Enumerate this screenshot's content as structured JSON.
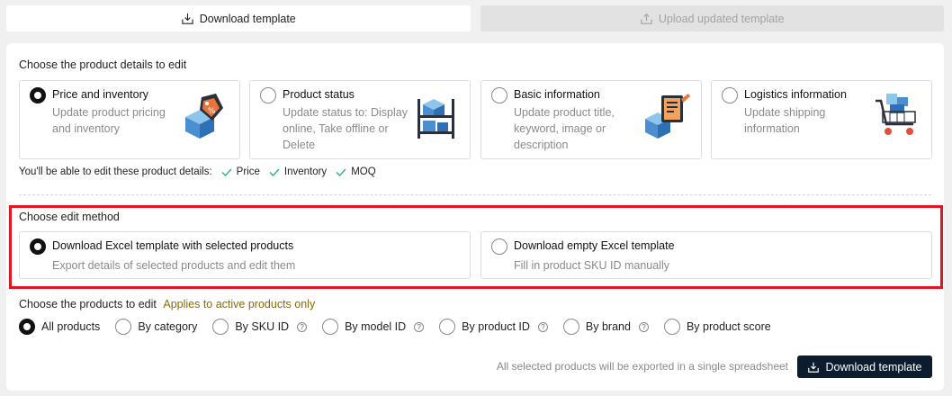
{
  "tabs": {
    "download": "Download template",
    "upload": "Upload updated template"
  },
  "details": {
    "title": "Choose the product details to edit",
    "cards": [
      {
        "title": "Price and inventory",
        "desc": "Update product pricing and inventory",
        "selected": true,
        "icon": "price-tag-box-icon"
      },
      {
        "title": "Product status",
        "desc": "Update status to: Display online, Take offline or Delete",
        "selected": false,
        "icon": "shelf-boxes-icon"
      },
      {
        "title": "Basic information",
        "desc": "Update product title, keyword, image or description",
        "selected": false,
        "icon": "document-box-icon"
      },
      {
        "title": "Logistics information",
        "desc": "Update shipping information",
        "selected": false,
        "icon": "shopping-cart-icon"
      }
    ],
    "editable_intro": "You'll be able to edit these product details:",
    "editable_items": [
      "Price",
      "Inventory",
      "MOQ"
    ]
  },
  "method": {
    "title": "Choose edit method",
    "options": [
      {
        "title": "Download Excel template with selected products",
        "desc": "Export details of selected products and edit them",
        "selected": true
      },
      {
        "title": "Download empty Excel template",
        "desc": "Fill in product SKU ID manually",
        "selected": false
      }
    ]
  },
  "products": {
    "title": "Choose the products to edit",
    "note": "Applies to active products only",
    "options": [
      {
        "label": "All products",
        "selected": true,
        "help": false
      },
      {
        "label": "By category",
        "selected": false,
        "help": false
      },
      {
        "label": "By SKU ID",
        "selected": false,
        "help": true
      },
      {
        "label": "By model ID",
        "selected": false,
        "help": true
      },
      {
        "label": "By product ID",
        "selected": false,
        "help": true
      },
      {
        "label": "By brand",
        "selected": false,
        "help": true
      },
      {
        "label": "By product score",
        "selected": false,
        "help": false
      }
    ],
    "help_glyph": "?"
  },
  "footer": {
    "note": "All selected products will be exported in a single spreadsheet",
    "button": "Download template"
  },
  "colors": {
    "accent_dark": "#0d1b2e",
    "highlight": "#e0151f",
    "check": "#2bb07a",
    "note": "#8a6a00"
  }
}
